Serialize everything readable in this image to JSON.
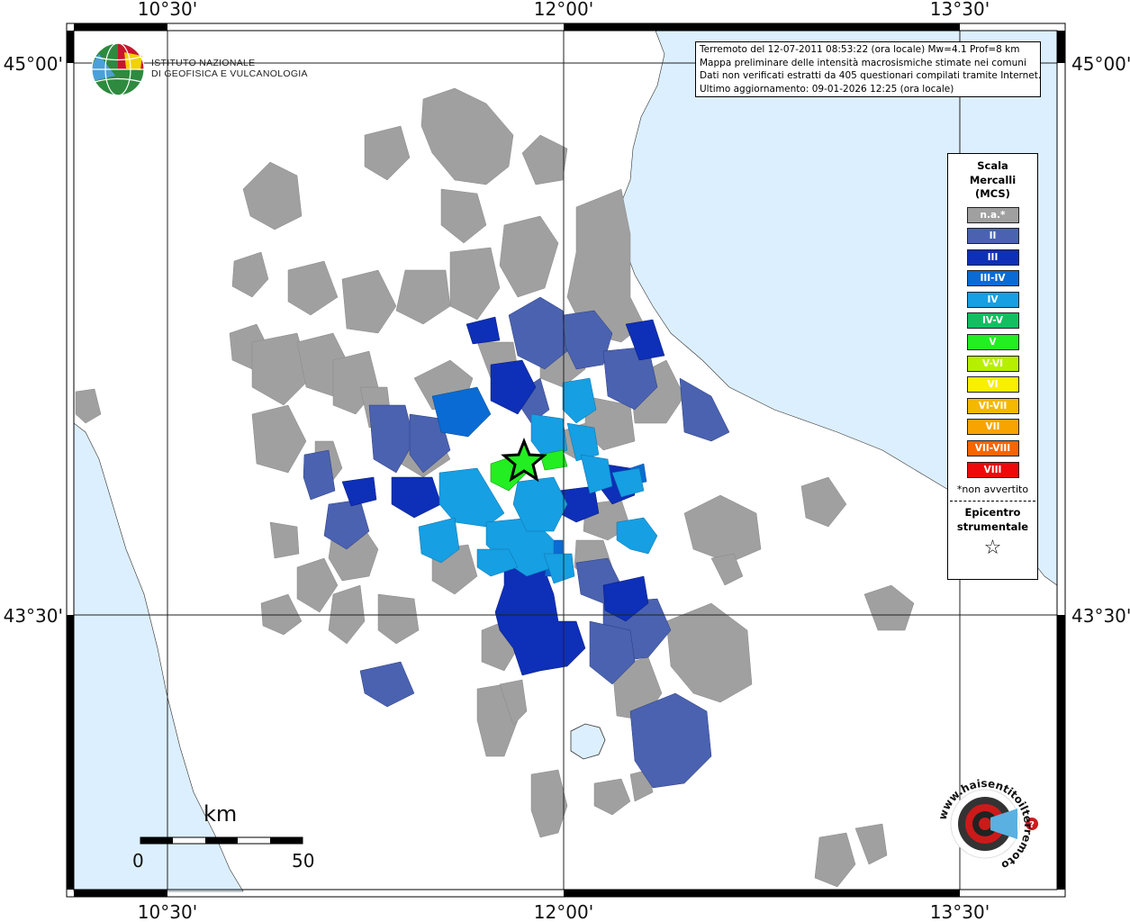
{
  "map": {
    "lon_labels": [
      "10°30'",
      "12°00'",
      "13°30'"
    ],
    "lat_labels": [
      "45°00'",
      "43°30'"
    ]
  },
  "header": {
    "lines": [
      "Terremoto del 12-07-2011 08:53:22 (ora locale) Mw=4.1 Prof=8 km",
      "Mappa preliminare delle intensità macrosismiche stimate nei comuni",
      "Dati non verificati estratti da 405 questionari compilati tramite Internet.",
      "Ultimo aggiornamento: 09-01-2026 12:25 (ora locale)"
    ]
  },
  "logo": {
    "line1": "ISTITUTO NAZIONALE",
    "line2": "DI GEOFISICA E VULCANOLOGIA",
    "secondary_text": "www.haisentitoilterremoto.it"
  },
  "legend": {
    "title_lines": [
      "Scala",
      "Mercalli",
      "(MCS)"
    ],
    "items": [
      {
        "label": "n.a.*",
        "color": "#a0a0a0"
      },
      {
        "label": "II",
        "color": "#4a62b0"
      },
      {
        "label": "III",
        "color": "#0e2fb8"
      },
      {
        "label": "III-IV",
        "color": "#0a6bd4"
      },
      {
        "label": "IV",
        "color": "#169fe3"
      },
      {
        "label": "IV-V",
        "color": "#10c060"
      },
      {
        "label": "V",
        "color": "#22ee22"
      },
      {
        "label": "V-VI",
        "color": "#b6f000"
      },
      {
        "label": "VI",
        "color": "#f8f000"
      },
      {
        "label": "VI-VII",
        "color": "#f5b800"
      },
      {
        "label": "VII",
        "color": "#f8a400"
      },
      {
        "label": "VII-VIII",
        "color": "#f86400"
      },
      {
        "label": "VIII",
        "color": "#ee0a0a"
      }
    ],
    "note": "*non avvertito",
    "epicenter_lines": [
      "Epicentro",
      "strumentale"
    ]
  },
  "scalebar": {
    "unit": "km",
    "min_label": "0",
    "max_label": "50"
  },
  "colors": {
    "sea": "#dcefff",
    "land": "#ffffff",
    "na": "#a0a0a0"
  }
}
